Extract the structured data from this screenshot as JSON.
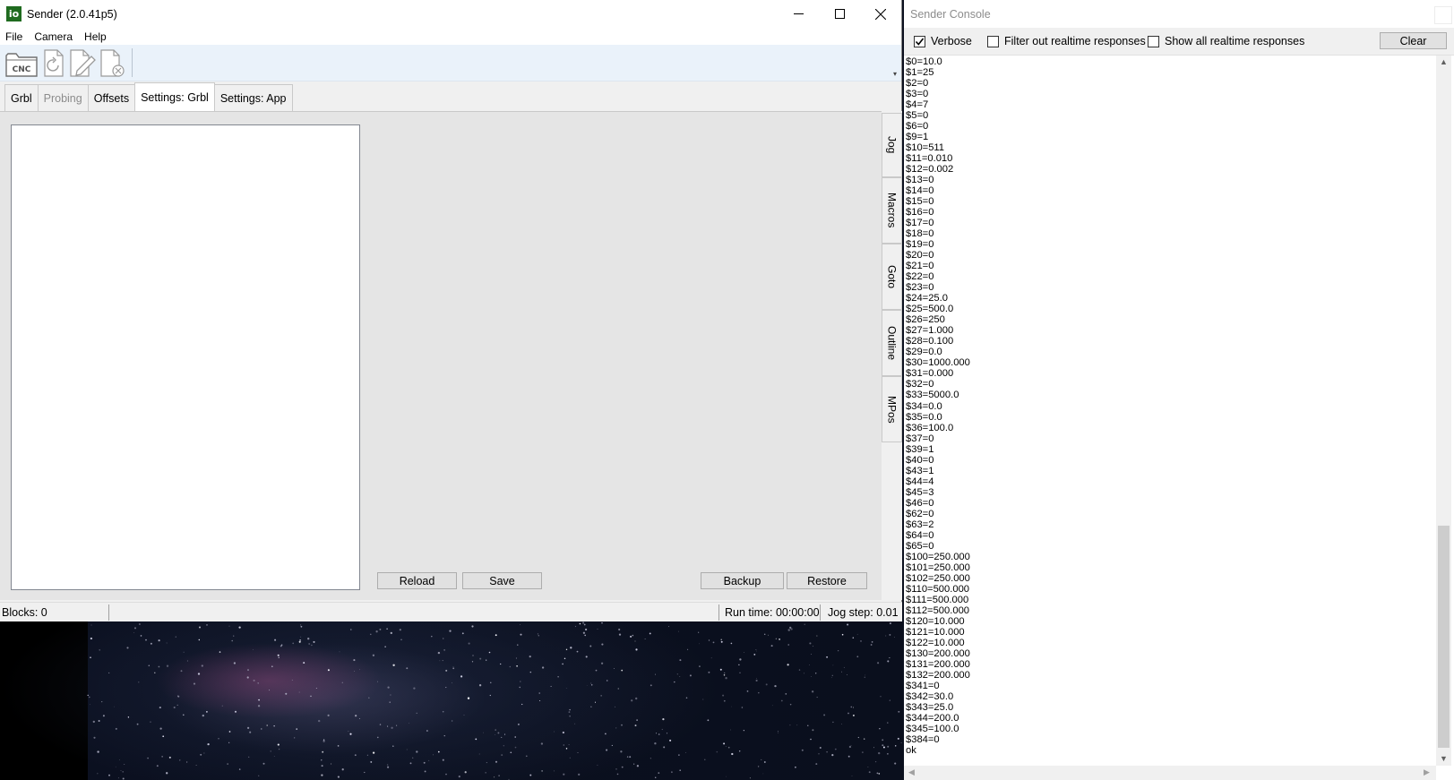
{
  "sender": {
    "title": "Sender (2.0.41p5)",
    "app_icon_text": "io",
    "menu": [
      "File",
      "Camera",
      "Help"
    ],
    "toolbar_icons": [
      "open-cnc-file-icon",
      "reload-icon",
      "edit-icon",
      "close-file-icon"
    ],
    "cnc_label": "CNC",
    "tabs": [
      {
        "label": "Grbl",
        "state": "normal"
      },
      {
        "label": "Probing",
        "state": "disabled"
      },
      {
        "label": "Offsets",
        "state": "normal"
      },
      {
        "label": "Settings: Grbl",
        "state": "active"
      },
      {
        "label": "Settings: App",
        "state": "normal"
      }
    ],
    "buttons": {
      "reload": "Reload",
      "save": "Save",
      "backup": "Backup",
      "restore": "Restore"
    },
    "side_tabs": [
      "Jog",
      "Macros",
      "Goto",
      "Outline",
      "MPos"
    ],
    "status": {
      "blocks": "Blocks: 0",
      "run_time": "Run time: 00:00:00",
      "jog_step": "Jog step: 0.01"
    }
  },
  "console": {
    "title": "Sender Console",
    "verbose": {
      "label": "Verbose",
      "checked": true
    },
    "filter_realtime": {
      "label": "Filter out realtime responses",
      "checked": false
    },
    "show_realtime": {
      "label": "Show all realtime responses",
      "checked": false
    },
    "clear": "Clear",
    "lines": [
      "$0=10.0",
      "$1=25",
      "$2=0",
      "$3=0",
      "$4=7",
      "$5=0",
      "$6=0",
      "$9=1",
      "$10=511",
      "$11=0.010",
      "$12=0.002",
      "$13=0",
      "$14=0",
      "$15=0",
      "$16=0",
      "$17=0",
      "$18=0",
      "$19=0",
      "$20=0",
      "$21=0",
      "$22=0",
      "$23=0",
      "$24=25.0",
      "$25=500.0",
      "$26=250",
      "$27=1.000",
      "$28=0.100",
      "$29=0.0",
      "$30=1000.000",
      "$31=0.000",
      "$32=0",
      "$33=5000.0",
      "$34=0.0",
      "$35=0.0",
      "$36=100.0",
      "$37=0",
      "$39=1",
      "$40=0",
      "$43=1",
      "$44=4",
      "$45=3",
      "$46=0",
      "$62=0",
      "$63=2",
      "$64=0",
      "$65=0",
      "$100=250.000",
      "$101=250.000",
      "$102=250.000",
      "$110=500.000",
      "$111=500.000",
      "$112=500.000",
      "$120=10.000",
      "$121=10.000",
      "$122=10.000",
      "$130=200.000",
      "$131=200.000",
      "$132=200.000",
      "$341=0",
      "$342=30.0",
      "$343=25.0",
      "$344=200.0",
      "$345=100.0",
      "$384=0",
      "ok"
    ]
  }
}
